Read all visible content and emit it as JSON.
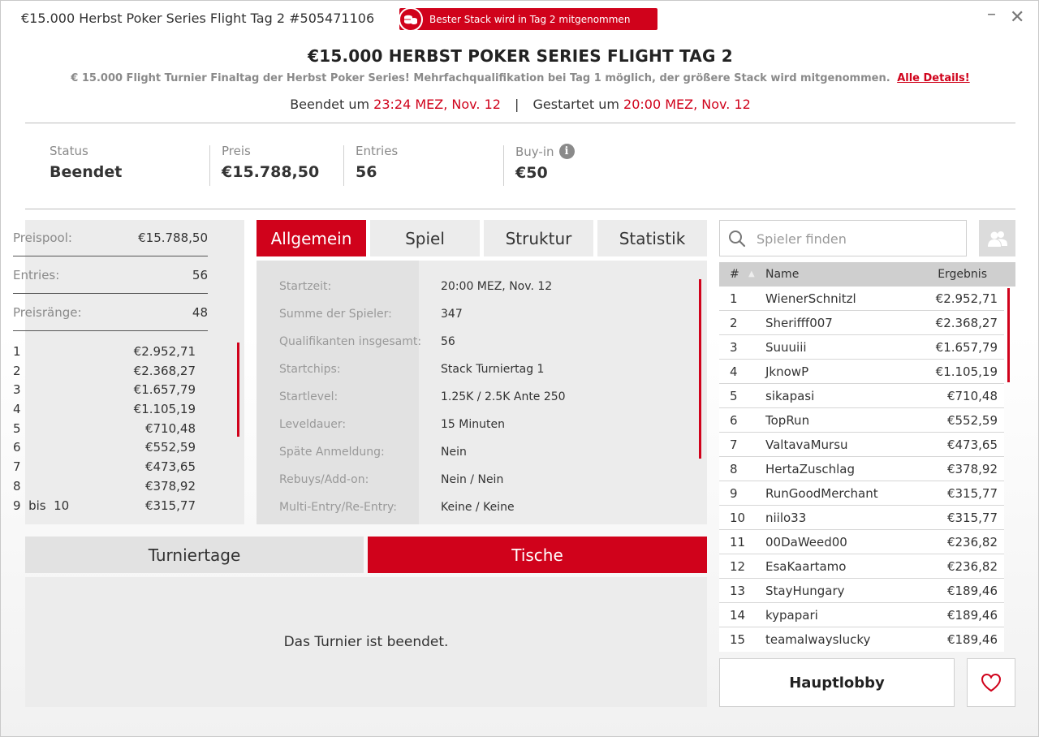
{
  "window": {
    "title": "€15.000 Herbst Poker Series Flight Tag 2 #505471106",
    "badge": "Bester Stack wird in Tag 2 mitgenommen",
    "minimize": "–",
    "close": "✕"
  },
  "header": {
    "title": "€15.000 HERBST POKER SERIES FLIGHT TAG 2",
    "subtitle": "€ 15.000 Flight Turnier Finaltag der Herbst Poker Series! Mehrfachqualifikation bei Tag 1 möglich, der größere Stack wird mitgenommen.",
    "details_link": "Alle Details!",
    "ended_label": "Beendet um",
    "ended_time": "23:24 MEZ, Nov. 12",
    "started_label": "Gestartet um",
    "started_time": "20:00 MEZ, Nov. 12",
    "separator": "|"
  },
  "stats": {
    "status_label": "Status",
    "status_value": "Beendet",
    "prize_label": "Preis",
    "prize_value": "€15.788,50",
    "entries_label": "Entries",
    "entries_value": "56",
    "buyin_label": "Buy-in",
    "buyin_value": "€50"
  },
  "prize_panel": {
    "pool_label": "Preispool:",
    "pool_value": "€15.788,50",
    "entries_label": "Entries:",
    "entries_value": "56",
    "ranks_label": "Preisränge:",
    "ranks_value": "48",
    "payouts": [
      {
        "place": "1",
        "amount": "€2.952,71"
      },
      {
        "place": "2",
        "amount": "€2.368,27"
      },
      {
        "place": "3",
        "amount": "€1.657,79"
      },
      {
        "place": "4",
        "amount": "€1.105,19"
      },
      {
        "place": "5",
        "amount": "€710,48"
      },
      {
        "place": "6",
        "amount": "€552,59"
      },
      {
        "place": "7",
        "amount": "€473,65"
      },
      {
        "place": "8",
        "amount": "€378,92"
      },
      {
        "place": "9  bis  10",
        "amount": "€315,77"
      }
    ]
  },
  "tabs": [
    "Allgemein",
    "Spiel",
    "Struktur",
    "Statistik"
  ],
  "info": [
    {
      "k": "Startzeit:",
      "v": "20:00 MEZ, Nov. 12"
    },
    {
      "k": "Summe der Spieler:",
      "v": "347"
    },
    {
      "k": "Qualifikanten insgesamt:",
      "v": "56"
    },
    {
      "k": "Startchips:",
      "v": "Stack Turniertag 1"
    },
    {
      "k": "Startlevel:",
      "v": "1.25K / 2.5K Ante 250"
    },
    {
      "k": "Leveldauer:",
      "v": "15 Minuten"
    },
    {
      "k": "Späte Anmeldung:",
      "v": "Nein"
    },
    {
      "k": "Rebuys/Add-on:",
      "v": "Nein / Nein"
    },
    {
      "k": "Multi-Entry/Re-Entry:",
      "v": "Keine / Keine"
    }
  ],
  "bottom_tabs": {
    "days": "Turniertage",
    "tables": "Tische"
  },
  "ended_message": "Das Turnier ist beendet.",
  "search": {
    "placeholder": "Spieler finden"
  },
  "leaderboard": {
    "col_rank": "#",
    "col_name": "Name",
    "col_result": "Ergebnis",
    "rows": [
      {
        "rank": "1",
        "name": "WienerSchnitzl",
        "prize": "€2.952,71"
      },
      {
        "rank": "2",
        "name": "Sherifff007",
        "prize": "€2.368,27"
      },
      {
        "rank": "3",
        "name": "Suuuiii",
        "prize": "€1.657,79"
      },
      {
        "rank": "4",
        "name": "JknowP",
        "prize": "€1.105,19"
      },
      {
        "rank": "5",
        "name": "sikapasi",
        "prize": "€710,48"
      },
      {
        "rank": "6",
        "name": "TopRun",
        "prize": "€552,59"
      },
      {
        "rank": "7",
        "name": "ValtavaMursu",
        "prize": "€473,65"
      },
      {
        "rank": "8",
        "name": "HertaZuschlag",
        "prize": "€378,92"
      },
      {
        "rank": "9",
        "name": "RunGoodMerchant",
        "prize": "€315,77"
      },
      {
        "rank": "10",
        "name": "niilo33",
        "prize": "€315,77"
      },
      {
        "rank": "11",
        "name": "00DaWeed00",
        "prize": "€236,82"
      },
      {
        "rank": "12",
        "name": "EsaKaartamo",
        "prize": "€236,82"
      },
      {
        "rank": "13",
        "name": "StayHungary",
        "prize": "€189,46"
      },
      {
        "rank": "14",
        "name": "kypapari",
        "prize": "€189,46"
      },
      {
        "rank": "15",
        "name": "teamalwayslucky",
        "prize": "€189,46"
      }
    ]
  },
  "buttons": {
    "lobby": "Hauptlobby"
  },
  "colors": {
    "accent": "#d0021b",
    "panel": "#ececec",
    "text": "#333333"
  }
}
